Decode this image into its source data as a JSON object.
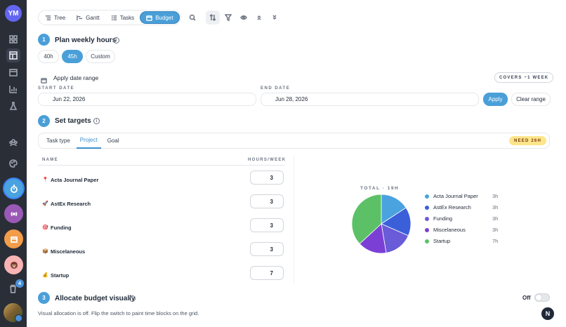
{
  "sidebar": {
    "user_initials": "YM",
    "nav_icons": [
      "grid-icon",
      "layout-icon",
      "calendar-icon",
      "chart-icon",
      "flask-icon",
      "team-icon",
      "palette-icon"
    ],
    "workspaces": [
      "timer-workspace",
      "broadcast-workspace",
      "calendar-workspace",
      "face-workspace"
    ],
    "trash_count": "4"
  },
  "toolbar": {
    "tabs": [
      {
        "label": "Tree",
        "icon": "tree-icon",
        "active": false
      },
      {
        "label": "Gantt",
        "icon": "gantt-icon",
        "active": false
      },
      {
        "label": "Tasks",
        "icon": "tasks-icon",
        "active": false
      },
      {
        "label": "Budget",
        "icon": "budget-icon",
        "active": true
      }
    ],
    "icons": [
      "search-icon",
      "sort-icon",
      "filter-icon",
      "eye-icon",
      "chevrons-up-icon",
      "chevrons-down-icon"
    ]
  },
  "step1": {
    "number": "1",
    "title": "Plan weekly hours",
    "options": [
      "40h",
      "45h",
      "Custom"
    ],
    "selected": "45h"
  },
  "date_range": {
    "label": "Apply date range",
    "covers": "COVERS ~1 WEEK",
    "start_label": "START DATE",
    "start_value": "Jun 22, 2026",
    "end_label": "END DATE",
    "end_value": "Jun 28, 2026",
    "apply_label": "Apply",
    "clear_label": "Clear range"
  },
  "step2": {
    "number": "2",
    "title": "Set targets",
    "tabs": [
      "Task type",
      "Project",
      "Goal"
    ],
    "active_tab": "Project",
    "need_badge": "NEED 26H",
    "col_name": "NAME",
    "col_hours": "HOURS/WEEK",
    "projects": [
      {
        "emoji": "📍",
        "name": "Acta Journal Paper",
        "hours": "3"
      },
      {
        "emoji": "🚀",
        "name": "AstEx Research",
        "hours": "3"
      },
      {
        "emoji": "🎯",
        "name": "Funding",
        "hours": "3"
      },
      {
        "emoji": "📦",
        "name": "Miscelaneous",
        "hours": "3"
      },
      {
        "emoji": "💰",
        "name": "Startup",
        "hours": "7"
      }
    ]
  },
  "chart_data": {
    "type": "pie",
    "title": "TOTAL · 19H",
    "categories": [
      "Acta Journal Paper",
      "AstEx Research",
      "Funding",
      "Miscelaneous",
      "Startup"
    ],
    "values": [
      3,
      3,
      3,
      3,
      7
    ],
    "value_labels": [
      "3h",
      "3h",
      "3h",
      "3h",
      "7h"
    ],
    "colors": [
      "#4aa3df",
      "#3a5fd9",
      "#6a5bd8",
      "#7b3fd6",
      "#5cc166"
    ],
    "legend": "right"
  },
  "step3": {
    "number": "3",
    "title": "Allocate budget visually",
    "toggle_label": "Off",
    "toggle_on": false,
    "description": "Visual allocation is off. Flip the switch to paint time blocks on the grid."
  },
  "footer": {
    "logo_letter": "N"
  }
}
